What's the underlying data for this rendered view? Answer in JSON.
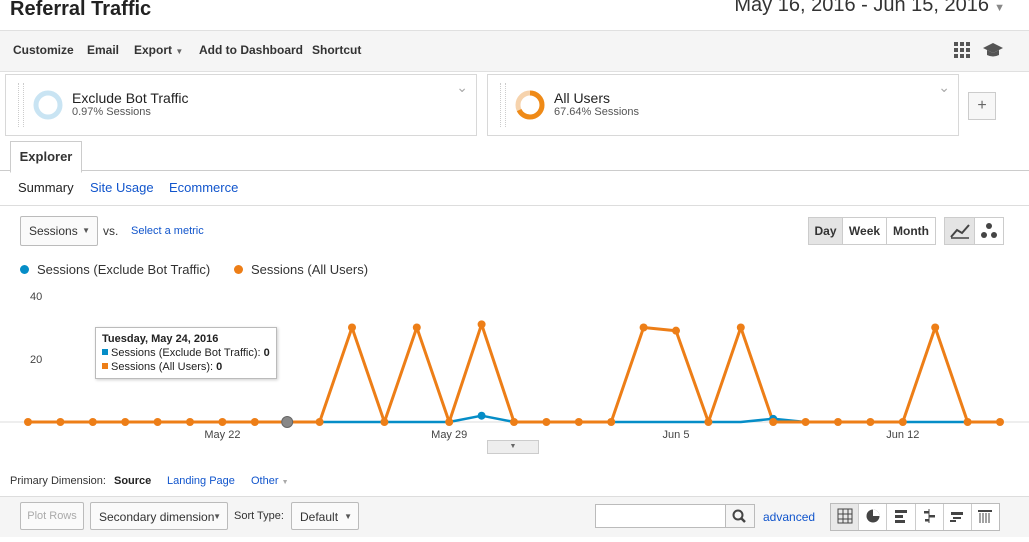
{
  "page": {
    "title": "Referral Traffic",
    "date_range": "May 16, 2016 - Jun 15, 2016"
  },
  "toolbar": {
    "customize": "Customize",
    "email": "Email",
    "export": "Export",
    "add_to_dashboard": "Add to Dashboard",
    "shortcut": "Shortcut"
  },
  "segments": [
    {
      "name": "Exclude Bot Traffic",
      "sub": "0.97% Sessions",
      "color": "#c9e4f3"
    },
    {
      "name": "All Users",
      "sub": "67.64% Sessions",
      "color": "#ef8a17"
    }
  ],
  "tabs": {
    "explorer": "Explorer"
  },
  "subtabs": {
    "summary": "Summary",
    "site_usage": "Site Usage",
    "ecommerce": "Ecommerce"
  },
  "metric": {
    "selected": "Sessions",
    "vs": "vs.",
    "select_metric": "Select a metric"
  },
  "granularity": {
    "day": "Day",
    "week": "Week",
    "month": "Month",
    "active": "Day"
  },
  "legend": {
    "series1": "Sessions (Exclude Bot Traffic)",
    "series2": "Sessions (All Users)"
  },
  "tooltip": {
    "date": "Tuesday, May 24, 2016",
    "line1_label": "Sessions (Exclude Bot Traffic):",
    "line1_value": "0",
    "line2_label": "Sessions (All Users):",
    "line2_value": "0"
  },
  "chart_data": {
    "type": "line",
    "x": [
      "May 16",
      "May 17",
      "May 18",
      "May 19",
      "May 20",
      "May 21",
      "May 22",
      "May 23",
      "May 24",
      "May 25",
      "May 26",
      "May 27",
      "May 28",
      "May 29",
      "May 30",
      "May 31",
      "Jun 1",
      "Jun 2",
      "Jun 3",
      "Jun 4",
      "Jun 5",
      "Jun 6",
      "Jun 7",
      "Jun 8",
      "Jun 9",
      "Jun 10",
      "Jun 11",
      "Jun 12",
      "Jun 13",
      "Jun 14",
      "Jun 15"
    ],
    "x_tick_labels": [
      "May 22",
      "May 29",
      "Jun 5",
      "Jun 12"
    ],
    "y_tick_labels": [
      "20",
      "40"
    ],
    "ylim": [
      0,
      40
    ],
    "series": [
      {
        "name": "Sessions (Exclude Bot Traffic)",
        "color": "#058dc7",
        "values": [
          0,
          0,
          0,
          0,
          0,
          0,
          0,
          0,
          0,
          0,
          0,
          0,
          0,
          0,
          2,
          0,
          0,
          0,
          0,
          0,
          0,
          0,
          0,
          1,
          0,
          0,
          0,
          0,
          0,
          0,
          0
        ]
      },
      {
        "name": "Sessions (All Users)",
        "color": "#ed7e17",
        "values": [
          0,
          0,
          0,
          0,
          0,
          0,
          0,
          0,
          0,
          0,
          30,
          0,
          30,
          0,
          31,
          0,
          0,
          0,
          0,
          30,
          29,
          0,
          30,
          0,
          0,
          0,
          0,
          0,
          30,
          0,
          0
        ]
      }
    ],
    "highlight_index": 8
  },
  "primary_dimension": {
    "label": "Primary Dimension:",
    "source": "Source",
    "landing_page": "Landing Page",
    "other": "Other"
  },
  "table_controls": {
    "plot_rows": "Plot Rows",
    "secondary_dimension": "Secondary dimension",
    "sort_type_label": "Sort Type:",
    "sort_type": "Default",
    "advanced": "advanced"
  }
}
